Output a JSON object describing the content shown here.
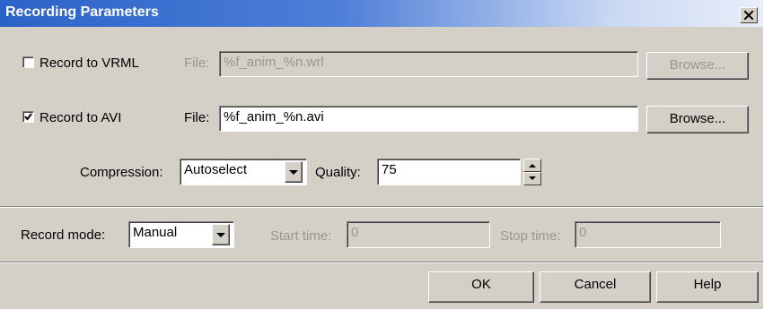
{
  "window": {
    "title": "Recording Parameters"
  },
  "vrml": {
    "checkbox_label": "Record to VRML",
    "checked": false,
    "file_label": "File:",
    "file_value": "%f_anim_%n.wrl",
    "browse_label": "Browse...",
    "enabled": false
  },
  "avi": {
    "checkbox_label": "Record to AVI",
    "checked": true,
    "file_label": "File:",
    "file_value": "%f_anim_%n.avi",
    "browse_label": "Browse...",
    "compression_label": "Compression:",
    "compression_value": "Autoselect",
    "quality_label": "Quality:",
    "quality_value": "75"
  },
  "record": {
    "mode_label": "Record mode:",
    "mode_value": "Manual",
    "start_label": "Start time:",
    "start_value": "0",
    "stop_label": "Stop time:",
    "stop_value": "0"
  },
  "buttons": {
    "ok": "OK",
    "cancel": "Cancel",
    "help": "Help"
  },
  "colors": {
    "face": "#d4d0c8",
    "title_start": "#2a63c8",
    "disabled_text": "#9a968e"
  }
}
